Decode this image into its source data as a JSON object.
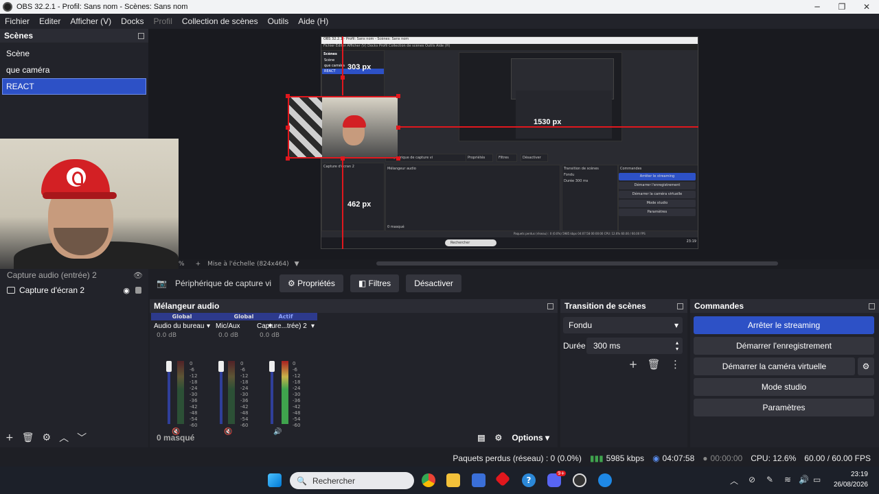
{
  "window": {
    "title": "OBS 32.2.1 - Profil: Sans nom - Scènes: Sans nom",
    "min": "─",
    "max": "❐",
    "close": "✕"
  },
  "menu": [
    "Fichier",
    "Editer",
    "Afficher (V)",
    "Docks",
    "Profil",
    "Collection de scènes",
    "Outils",
    "Aide (H)"
  ],
  "scenes": {
    "title": "Scènes",
    "items": [
      "Scène",
      "que caméra",
      "REACT"
    ],
    "active": "REACT"
  },
  "preview": {
    "labels": {
      "top": "303 px",
      "right": "1530 px",
      "bottom": "462 px"
    },
    "scale_label": "Mise à l'échelle (824x464)",
    "scale_left": "%",
    "scale_plus": "+",
    "nested": {
      "title": "OBS 32.2.1 - Profil: Sans nom - Scènes: Sans nom",
      "menu": "Fichier  Editer  Afficher (V)  Docks  Profil  Collection de scènes  Outils  Aide (H)",
      "scenes": [
        "Scènes",
        "Scène",
        "que caméra",
        "REACT"
      ],
      "bar": [
        "Périphérique de capture vi",
        "Propriétés",
        "Filtres",
        "Désactiver"
      ],
      "source": "Capture d'écran 2",
      "mixer": "Mélangeur audio",
      "masked": "0 masqué",
      "trans_title": "Transition de scènes",
      "trans": "Fondu",
      "dur_lbl": "Durée",
      "dur": "300 ms",
      "cmd_title": "Commandes",
      "cmds": [
        "Arrêter le streaming",
        "Démarrer l'enregistrement",
        "Démarrer la caméra virtuelle",
        "Mode studio",
        "Paramètres"
      ],
      "status": "Paquets perdus (réseau) : 0 (0.0%)   5985 kbps   04:07:58   00:00:00   CPU: 12.6%   60.00 / 60.00 FPS",
      "search": "Rechercher",
      "clock": "23:19"
    }
  },
  "source_bar": {
    "device": "Périphérique de capture vi",
    "props": "Propriétés",
    "filters": "Filtres",
    "disable": "Désactiver"
  },
  "sources": {
    "items": [
      {
        "name": "Capture audio (entrée) 2"
      },
      {
        "name": "Capture d'écran 2"
      }
    ]
  },
  "mixer": {
    "title": "Mélangeur audio",
    "channels": [
      {
        "scope": "Global",
        "name": "Audio du bureau",
        "db": "0.0 dB"
      },
      {
        "scope": "Global",
        "name": "Mic/Aux",
        "db": "0.0 dB"
      },
      {
        "scope": "Actif",
        "name": "Capture...trée) 2",
        "db": "0.0 dB"
      }
    ],
    "scale": [
      "0",
      "-6",
      "-12",
      "-18",
      "-24",
      "-30",
      "-36",
      "-42",
      "-48",
      "-54",
      "-60"
    ],
    "hidden": "0 masqué",
    "options": "Options"
  },
  "transition": {
    "title": "Transition de scènes",
    "type": "Fondu",
    "duration_label": "Durée",
    "duration": "300 ms"
  },
  "commands": {
    "title": "Commandes",
    "buttons": [
      "Arrêter le streaming",
      "Démarrer l'enregistrement",
      "Démarrer la caméra virtuelle",
      "Mode studio",
      "Paramètres"
    ]
  },
  "status": {
    "dropped": "Paquets perdus (réseau) : 0 (0.0%)",
    "bitrate": "5985 kbps",
    "stream_time": "04:07:58",
    "rec_time": "00:00:00",
    "cpu": "CPU: 12.6%",
    "fps": "60.00 / 60.00 FPS"
  },
  "taskbar": {
    "search": "Rechercher",
    "time": "23:19",
    "date": "26/08/2026",
    "badge": "9+"
  },
  "colors": {
    "accent": "#2d51c6",
    "guide": "#e1171d"
  }
}
